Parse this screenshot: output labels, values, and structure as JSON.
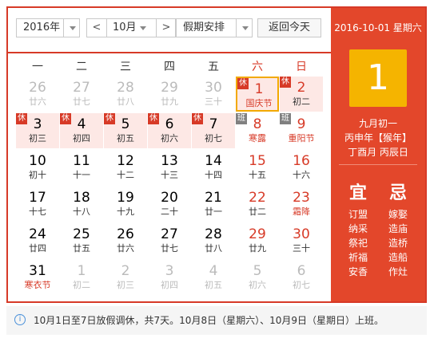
{
  "toolbar": {
    "year": "2016年",
    "prev": "<",
    "month": "10月",
    "next": ">",
    "holiday": "假期安排",
    "today": "返回今天"
  },
  "weekdays": [
    "一",
    "二",
    "三",
    "四",
    "五",
    "六",
    "日"
  ],
  "days": [
    {
      "n": "26",
      "s": "廿六",
      "dim": true
    },
    {
      "n": "27",
      "s": "廿七",
      "dim": true
    },
    {
      "n": "28",
      "s": "廿八",
      "dim": true
    },
    {
      "n": "29",
      "s": "廿九",
      "dim": true
    },
    {
      "n": "30",
      "s": "三十",
      "dim": true
    },
    {
      "n": "1",
      "s": "国庆节",
      "tag": "休",
      "hol": true,
      "fest": true,
      "today": true,
      "wk": true
    },
    {
      "n": "2",
      "s": "初二",
      "tag": "休",
      "hol": true,
      "wk": true
    },
    {
      "n": "3",
      "s": "初三",
      "tag": "休",
      "hol": true
    },
    {
      "n": "4",
      "s": "初四",
      "tag": "休",
      "hol": true
    },
    {
      "n": "5",
      "s": "初五",
      "tag": "休",
      "hol": true
    },
    {
      "n": "6",
      "s": "初六",
      "tag": "休",
      "hol": true
    },
    {
      "n": "7",
      "s": "初七",
      "tag": "休",
      "hol": true
    },
    {
      "n": "8",
      "s": "寒露",
      "tag": "班",
      "ban": true,
      "fest": true,
      "wk": true
    },
    {
      "n": "9",
      "s": "重阳节",
      "tag": "班",
      "ban": true,
      "fest": true,
      "wk": true
    },
    {
      "n": "10",
      "s": "初十"
    },
    {
      "n": "11",
      "s": "十一"
    },
    {
      "n": "12",
      "s": "十二"
    },
    {
      "n": "13",
      "s": "十三"
    },
    {
      "n": "14",
      "s": "十四"
    },
    {
      "n": "15",
      "s": "十五",
      "wk": true
    },
    {
      "n": "16",
      "s": "十六",
      "wk": true
    },
    {
      "n": "17",
      "s": "十七"
    },
    {
      "n": "18",
      "s": "十八"
    },
    {
      "n": "19",
      "s": "十九"
    },
    {
      "n": "20",
      "s": "二十"
    },
    {
      "n": "21",
      "s": "廿一"
    },
    {
      "n": "22",
      "s": "廿二",
      "wk": true
    },
    {
      "n": "23",
      "s": "霜降",
      "fest": true,
      "wk": true
    },
    {
      "n": "24",
      "s": "廿四"
    },
    {
      "n": "25",
      "s": "廿五"
    },
    {
      "n": "26",
      "s": "廿六"
    },
    {
      "n": "27",
      "s": "廿七"
    },
    {
      "n": "28",
      "s": "廿八"
    },
    {
      "n": "29",
      "s": "廿九",
      "wk": true
    },
    {
      "n": "30",
      "s": "三十",
      "wk": true
    },
    {
      "n": "31",
      "s": "寒衣节",
      "fest": true
    },
    {
      "n": "1",
      "s": "初二",
      "dim": true
    },
    {
      "n": "2",
      "s": "初三",
      "dim": true
    },
    {
      "n": "3",
      "s": "初四",
      "dim": true
    },
    {
      "n": "4",
      "s": "初五",
      "dim": true
    },
    {
      "n": "5",
      "s": "初六",
      "dim": true
    },
    {
      "n": "6",
      "s": "初七",
      "dim": true
    }
  ],
  "detail": {
    "date": "2016-10-01 星期六",
    "day": "1",
    "lunar": "九月初一",
    "ganzhi_year": "丙申年【猴年】",
    "ganzhi_md": "丁酉月 丙辰日",
    "yi": "宜",
    "ji": "忌",
    "yi_items": [
      "订盟",
      "纳采",
      "祭祀",
      "祈福",
      "安香"
    ],
    "ji_items": [
      "嫁娶",
      "造庙",
      "造桥",
      "造船",
      "作灶"
    ]
  },
  "notice": "10月1日至7日放假调休，共7天。10月8日（星期六）、10月9日（星期日）上班。",
  "colors": {
    "accent": "#d73a27",
    "panel": "#e3472b",
    "today_box": "#f5b400",
    "holiday_bg": "#fde8e5"
  }
}
